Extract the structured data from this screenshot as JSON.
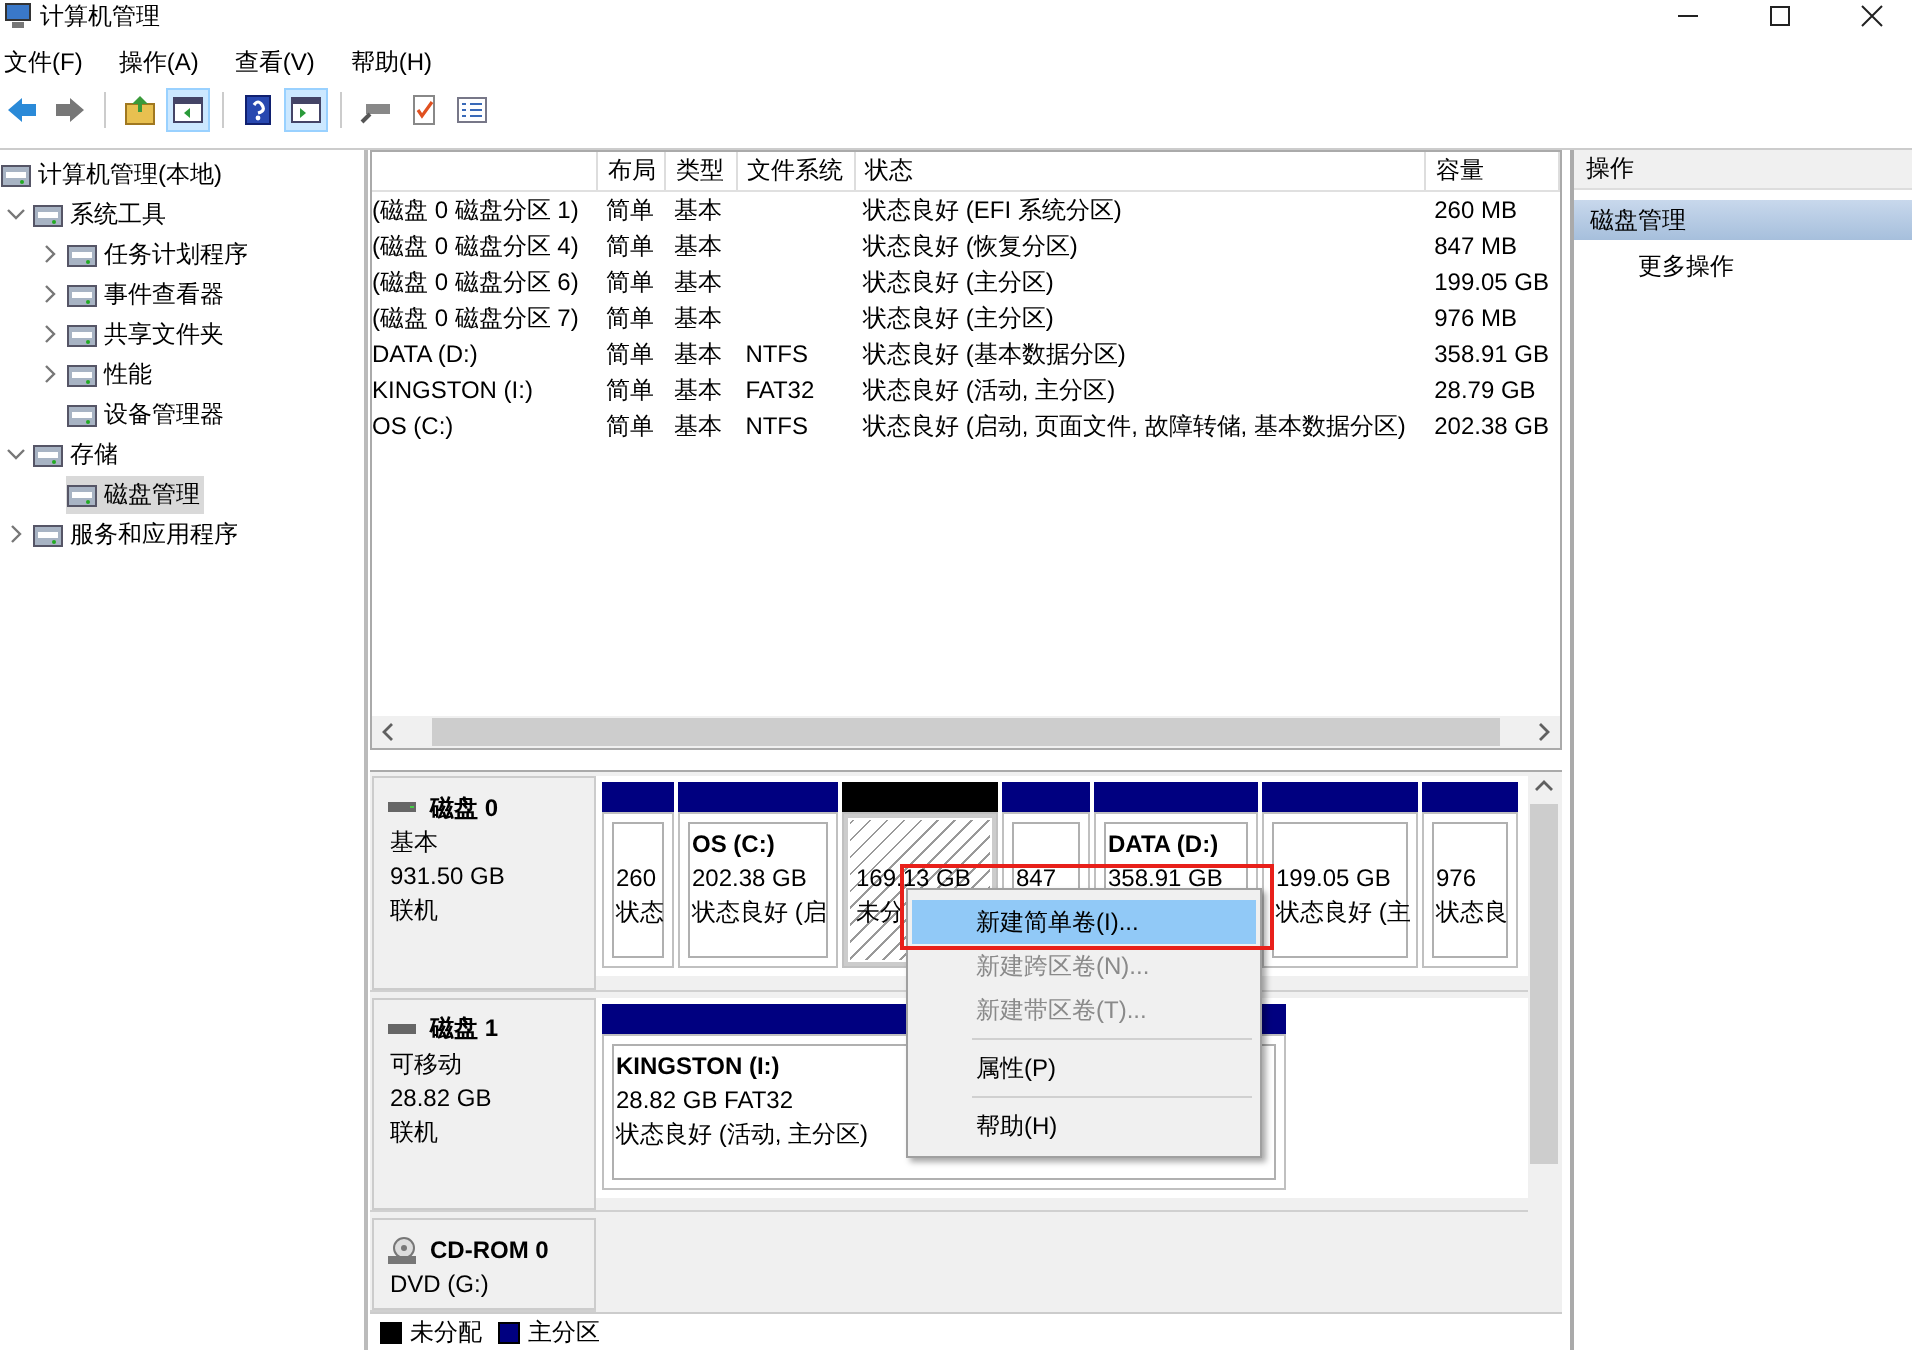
{
  "window": {
    "title": "计算机管理"
  },
  "menu": [
    "文件(F)",
    "操作(A)",
    "查看(V)",
    "帮助(H)"
  ],
  "toolbar": [
    {
      "kind": "back",
      "pressed": false
    },
    {
      "kind": "forward",
      "pressed": false
    },
    {
      "kind": "up",
      "pressed": false
    },
    {
      "kind": "console-tree",
      "pressed": true
    },
    {
      "kind": "help",
      "pressed": false
    },
    {
      "kind": "action-pane",
      "pressed": true
    },
    {
      "kind": "connect",
      "pressed": false
    },
    {
      "kind": "properties",
      "pressed": false
    },
    {
      "kind": "list",
      "pressed": false
    }
  ],
  "tree": [
    {
      "label": "计算机管理(本地)",
      "selected": false,
      "children": [
        {
          "label": "系统工具",
          "expanded": true,
          "selected": false,
          "children": [
            {
              "label": "任务计划程序",
              "expanded": false,
              "selected": false
            },
            {
              "label": "事件查看器",
              "expanded": false,
              "selected": false
            },
            {
              "label": "共享文件夹",
              "expanded": false,
              "selected": false
            },
            {
              "label": "性能",
              "expanded": false,
              "selected": false
            },
            {
              "label": "设备管理器",
              "selected": false
            }
          ]
        },
        {
          "label": "存储",
          "expanded": true,
          "selected": false,
          "children": [
            {
              "label": "磁盘管理",
              "selected": true
            }
          ]
        },
        {
          "label": "服务和应用程序",
          "expanded": false,
          "selected": false
        }
      ]
    }
  ],
  "table": {
    "columns": [
      "布局",
      "类型",
      "文件系统",
      "状态",
      "容量"
    ],
    "rows": [
      {
        "column_1": "(磁盘 0 磁盘分区 1)",
        "layout": "简单",
        "type": "基本",
        "status": "状态良好 (EFI 系统分区)",
        "capacity": "260 MB"
      },
      {
        "column_1": "(磁盘 0 磁盘分区 4)",
        "layout": "简单",
        "type": "基本",
        "status": "状态良好 (恢复分区)",
        "capacity": "847 MB"
      },
      {
        "column_1": "(磁盘 0 磁盘分区 6)",
        "layout": "简单",
        "type": "基本",
        "status": "状态良好 (主分区)",
        "capacity": "199.05 GB"
      },
      {
        "column_1": "(磁盘 0 磁盘分区 7)",
        "layout": "简单",
        "type": "基本",
        "status": "状态良好 (主分区)",
        "capacity": "976 MB"
      },
      {
        "column_1": "DATA (D:)",
        "layout": "简单",
        "type": "基本",
        "file_system": "NTFS",
        "status": "状态良好 (基本数据分区)",
        "capacity": "358.91 GB"
      },
      {
        "column_1": "KINGSTON (I:)",
        "layout": "简单",
        "type": "基本",
        "file_system": "FAT32",
        "status": "状态良好 (活动, 主分区)",
        "capacity": "28.79 GB"
      },
      {
        "column_1": "OS (C:)",
        "layout": "简单",
        "type": "基本",
        "file_system": "NTFS",
        "status": "状态良好 (启动, 页面文件, 故障转储, 基本数据分区)",
        "capacity": "202.38 GB"
      }
    ]
  },
  "disks": [
    {
      "name": "磁盘 0",
      "kind": "hdd",
      "lines": [
        "基本",
        "931.50 GB",
        "联机"
      ],
      "partitions": [
        {
          "kind": "primary",
          "lines": [
            "260",
            "状态"
          ]
        },
        {
          "kind": "primary",
          "name": "OS  (C:)",
          "lines": [
            "202.38 GB",
            "状态良好 (启"
          ]
        },
        {
          "kind": "unallocated",
          "lines": [
            "169.13 GB",
            "未分"
          ]
        },
        {
          "kind": "primary",
          "lines": [
            "847"
          ]
        },
        {
          "kind": "primary",
          "name": "DATA  (D:)",
          "lines": [
            "358.91 GB"
          ]
        },
        {
          "kind": "primary",
          "lines": [
            "199.05 GB",
            "状态良好 (主"
          ]
        },
        {
          "kind": "primary",
          "lines": [
            "976",
            "状态良"
          ]
        }
      ]
    },
    {
      "name": "磁盘 1",
      "kind": "removable",
      "lines": [
        "可移动",
        "28.82 GB",
        "联机"
      ],
      "partitions": [
        {
          "kind": "primary",
          "name": "KINGSTON  (I:)",
          "lines": [
            "28.82 GB FAT32",
            "状态良好 (活动, 主分区)"
          ]
        }
      ]
    },
    {
      "name": "CD-ROM 0",
      "kind": "cdrom",
      "lines": [
        "DVD (G:)"
      ]
    }
  ],
  "legend": [
    {
      "label": "未分配",
      "color": "#000000"
    },
    {
      "label": "主分区",
      "color": "#000080"
    }
  ],
  "actions": {
    "header": "操作",
    "section": "磁盘管理",
    "items": [
      "更多操作"
    ]
  },
  "context_menu": [
    {
      "kind": "item",
      "label": "新建简单卷(I)...",
      "disabled": false,
      "selected": true
    },
    {
      "kind": "item",
      "label": "新建跨区卷(N)...",
      "disabled": true,
      "selected": false
    },
    {
      "kind": "item",
      "label": "新建带区卷(T)...",
      "disabled": true,
      "selected": false
    },
    {
      "kind": "separator"
    },
    {
      "kind": "item",
      "label": "属性(P)",
      "disabled": false,
      "selected": false
    },
    {
      "kind": "separator"
    },
    {
      "kind": "item",
      "label": "帮助(H)",
      "disabled": false,
      "selected": false
    }
  ]
}
